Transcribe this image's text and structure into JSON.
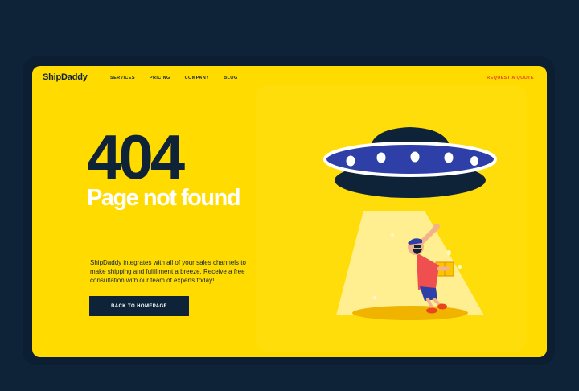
{
  "brand": {
    "name": "ShipDaddy"
  },
  "nav": {
    "items": [
      "SERVICES",
      "PRICING",
      "COMPANY",
      "BLOG"
    ],
    "cta": "REQUEST A QUOTE"
  },
  "error": {
    "code": "404",
    "title": "Page not found",
    "description": "ShipDaddy integrates with all of your sales channels to make shipping and fulfillment a breeze. Receive a free consultation with our team of experts today!",
    "button_label": "BACK TO HOMEPAGE"
  },
  "illustration": {
    "icon": "ufo-abduction-illustration"
  },
  "colors": {
    "background": "#0f2338",
    "screen": "#ffdb00",
    "primary": "#0f2338",
    "accent": "#e9451d",
    "ufo_band": "#2e3fa7"
  }
}
